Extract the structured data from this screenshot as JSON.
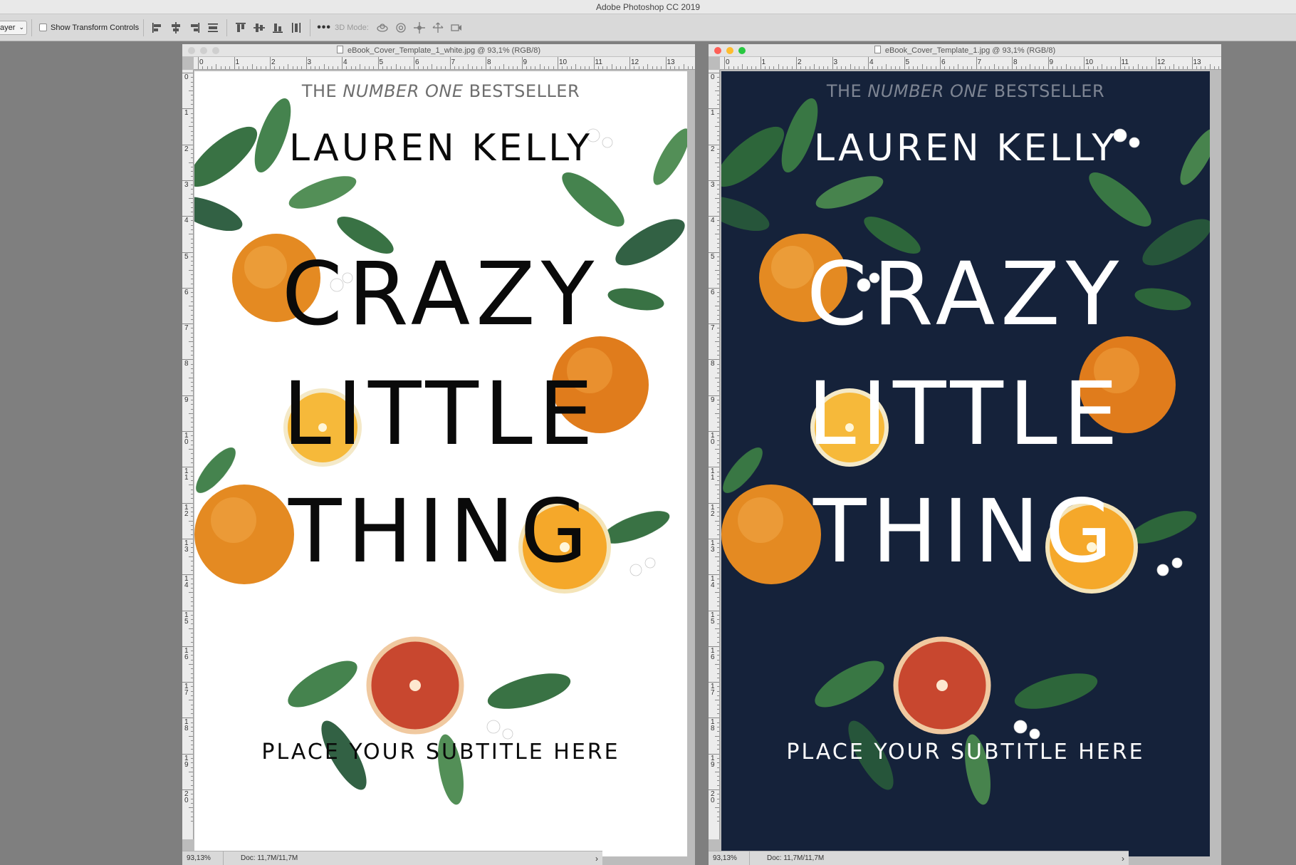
{
  "app": {
    "title": "Adobe Photoshop CC 2019"
  },
  "options_bar": {
    "layer_select_value": "ayer",
    "show_transform_label": "Show Transform Controls",
    "mode_label": "3D Mode:",
    "more_label": "•••"
  },
  "documents": [
    {
      "title": "eBook_Cover_Template_1_white.jpg @ 93,1% (RGB/8)",
      "zoom": "93,13%",
      "doc_size": "Doc: 11,7M/11,7M",
      "ruler_h": [
        "0",
        "1",
        "2",
        "3",
        "4",
        "5",
        "6",
        "7",
        "8",
        "9",
        "10",
        "11",
        "12",
        "13"
      ],
      "ruler_v": [
        "0",
        "1",
        "2",
        "3",
        "4",
        "5",
        "6",
        "7",
        "8",
        "9",
        "10",
        "11",
        "12",
        "13",
        "14",
        "15",
        "16",
        "17",
        "18",
        "19",
        "20"
      ]
    },
    {
      "title": "eBook_Cover_Template_1.jpg @ 93,1% (RGB/8)",
      "zoom": "93,13%",
      "doc_size": "Doc: 11,7M/11,7M",
      "ruler_h": [
        "0",
        "1",
        "2",
        "3",
        "4",
        "5",
        "6",
        "7",
        "8",
        "9",
        "10",
        "11",
        "12",
        "13"
      ],
      "ruler_v": [
        "0",
        "1",
        "2",
        "3",
        "4",
        "5",
        "6",
        "7",
        "8",
        "9",
        "10",
        "11",
        "12",
        "13",
        "14",
        "15",
        "16",
        "17",
        "18",
        "19",
        "20"
      ]
    }
  ],
  "cover": {
    "bestseller_pre": "THE ",
    "bestseller_em": "NUMBER ONE",
    "bestseller_post": " BESTSELLER",
    "author": "LAUREN KELLY",
    "title_line1": "CRAZY",
    "title_line2": "LITTLE",
    "title_line3": "THING",
    "subtitle": "PLACE YOUR SUBTITLE HERE"
  },
  "colors": {
    "navy_background": "#15223a",
    "white_background": "#ffffff",
    "orange": "#e48a22",
    "leaf": "#2f6b3a",
    "blood_orange": "#c8472f"
  }
}
